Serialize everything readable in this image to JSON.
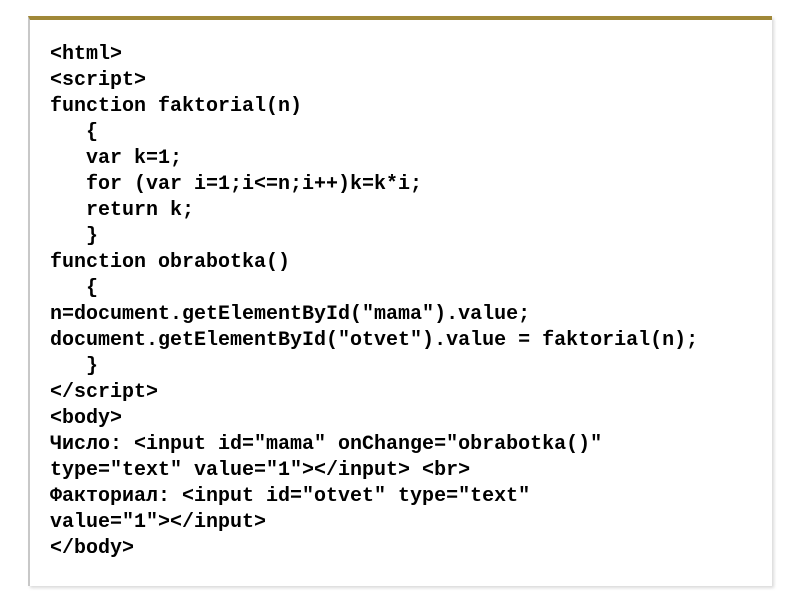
{
  "code": {
    "lines": [
      "<html>",
      "<script>",
      "function faktorial(n)",
      "   {",
      "   var k=1;",
      "   for (var i=1;i<=n;i++)k=k*i;",
      "   return k;",
      "   }",
      "function obrabotka()",
      "   {",
      "n=document.getElementById(\"mama\").value;",
      "document.getElementById(\"otvet\").value = faktorial(n);",
      "   }",
      "</script>",
      "<body>",
      "Число: <input id=\"mama\" onChange=\"obrabotka()\"",
      "type=\"text\" value=\"1\"></input> <br>",
      "Факториал: <input id=\"otvet\" type=\"text\"",
      "value=\"1\"></input>",
      "</body>"
    ]
  }
}
